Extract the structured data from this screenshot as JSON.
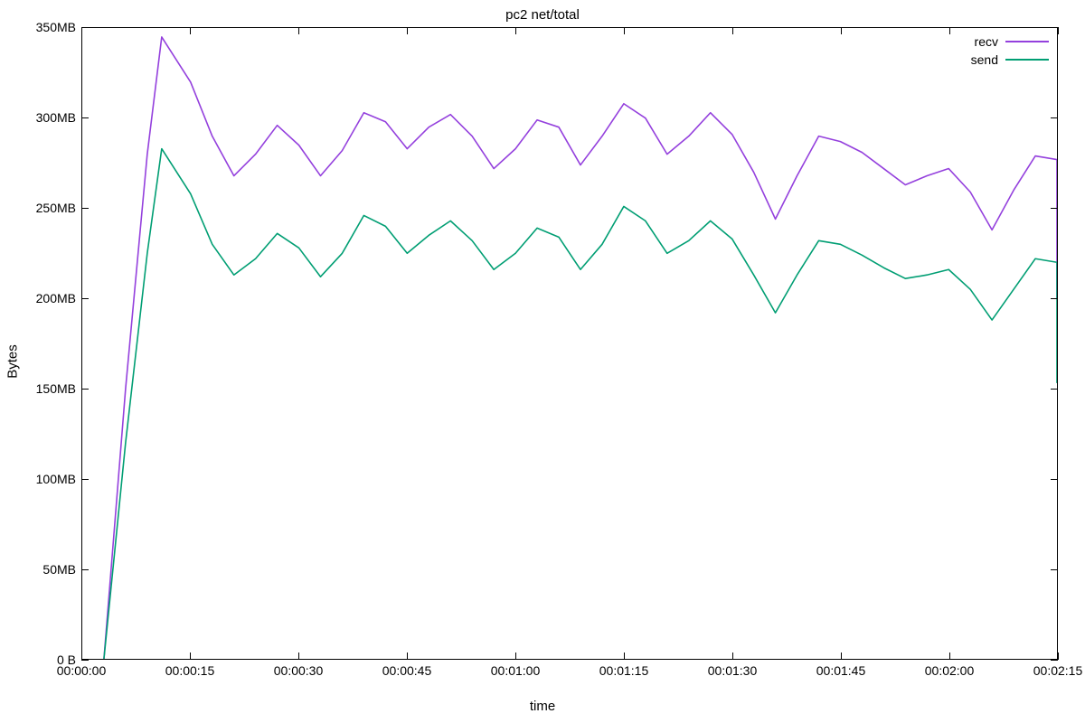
{
  "chart_data": {
    "type": "line",
    "title": "pc2 net/total",
    "xlabel": "time",
    "ylabel": "Bytes",
    "x_ticks": [
      "00:00:00",
      "00:00:15",
      "00:00:30",
      "00:00:45",
      "00:01:00",
      "00:01:15",
      "00:01:30",
      "00:01:45",
      "00:02:00",
      "00:02:15"
    ],
    "y_ticks": [
      "0 B",
      "50MB",
      "100MB",
      "150MB",
      "200MB",
      "250MB",
      "300MB",
      "350MB"
    ],
    "ylim": [
      0,
      350
    ],
    "xlim_seconds": [
      0,
      135
    ],
    "legend_position": "top-right",
    "colors": {
      "recv": "#9440dd",
      "send": "#009e73"
    },
    "series": [
      {
        "name": "recv",
        "x_seconds": [
          3,
          6,
          9,
          11,
          15,
          18,
          21,
          24,
          27,
          30,
          33,
          36,
          39,
          42,
          45,
          48,
          51,
          54,
          57,
          60,
          63,
          66,
          69,
          72,
          75,
          78,
          81,
          84,
          87,
          90,
          93,
          96,
          99,
          102,
          105,
          108,
          111,
          114,
          117,
          120,
          123,
          126,
          129,
          132,
          135
        ],
        "y_mb": [
          0,
          150,
          280,
          345,
          320,
          290,
          268,
          280,
          296,
          285,
          268,
          282,
          303,
          298,
          283,
          295,
          302,
          290,
          272,
          283,
          299,
          295,
          274,
          290,
          308,
          300,
          280,
          290,
          303,
          291,
          270,
          244,
          268,
          290,
          287,
          281,
          272,
          263,
          268,
          272,
          259,
          238,
          260,
          279,
          277
        ]
      },
      {
        "name": "send",
        "x_seconds": [
          3,
          6,
          9,
          11,
          15,
          18,
          21,
          24,
          27,
          30,
          33,
          36,
          39,
          42,
          45,
          48,
          51,
          54,
          57,
          60,
          63,
          66,
          69,
          72,
          75,
          78,
          81,
          84,
          87,
          90,
          93,
          96,
          99,
          102,
          105,
          108,
          111,
          114,
          117,
          120,
          123,
          126,
          129,
          132,
          135
        ],
        "y_mb": [
          0,
          120,
          225,
          283,
          258,
          230,
          213,
          222,
          236,
          228,
          212,
          225,
          246,
          240,
          225,
          235,
          243,
          232,
          216,
          225,
          239,
          234,
          216,
          230,
          251,
          243,
          225,
          232,
          243,
          233,
          213,
          192,
          213,
          232,
          230,
          224,
          217,
          211,
          213,
          216,
          205,
          188,
          205,
          222,
          220
        ]
      }
    ],
    "series_end": {
      "recv_last_mb": 200,
      "send_last_mb": 153
    }
  }
}
